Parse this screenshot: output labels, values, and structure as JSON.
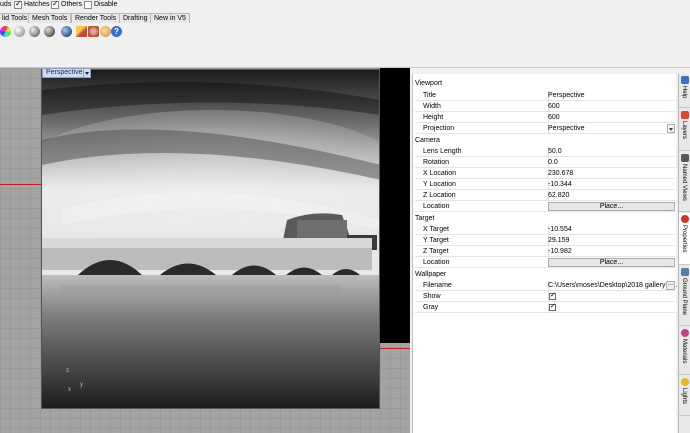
{
  "filter_bar": {
    "items": [
      {
        "label": "uds",
        "checked": true
      },
      {
        "label": "Hatches",
        "checked": true
      },
      {
        "label": "Others",
        "checked": true
      },
      {
        "label": "Disable",
        "checked": false
      }
    ]
  },
  "tabs": [
    "lid Tools",
    "Mesh Tools",
    "Render Tools",
    "Drafting",
    "New in V5"
  ],
  "toolbar_icons": [
    "color-wheel-icon",
    "shaded-sphere-icon",
    "render-sphere-icon",
    "material-sphere-icon",
    "blue-sphere-icon",
    "light-icon",
    "paint-icon",
    "environment-icon",
    "help-icon"
  ],
  "viewport": {
    "label": "Perspective",
    "axis_x": "x",
    "axis_y": "y",
    "axis_z": "z"
  },
  "properties": {
    "viewport_section": "Viewport",
    "viewport_rows": [
      {
        "key": "Title",
        "value": "Perspective"
      },
      {
        "key": "Width",
        "value": "600"
      },
      {
        "key": "Height",
        "value": "600"
      },
      {
        "key": "Projection",
        "value": "Perspective"
      }
    ],
    "camera_section": "Camera",
    "camera_rows": [
      {
        "key": "Lens Length",
        "value": "50.0"
      },
      {
        "key": "Rotation",
        "value": "0.0"
      },
      {
        "key": "X Location",
        "value": "230.678"
      },
      {
        "key": "Y Location",
        "value": "-10.344"
      },
      {
        "key": "Z Location",
        "value": "62.820"
      },
      {
        "key": "Location",
        "value": "Place..."
      }
    ],
    "target_section": "Target",
    "target_rows": [
      {
        "key": "X Target",
        "value": "-10.554"
      },
      {
        "key": "Y Target",
        "value": "29.159"
      },
      {
        "key": "Z Target",
        "value": "-10.982"
      },
      {
        "key": "Location",
        "value": "Place..."
      }
    ],
    "wallpaper_section": "Wallpaper",
    "wallpaper_rows": [
      {
        "key": "Filename",
        "value": "C:\\Users\\moses\\Desktop\\2018 gallery 3...",
        "button": "..."
      },
      {
        "key": "Show",
        "checked": true
      },
      {
        "key": "Gray",
        "checked": true
      }
    ]
  },
  "side_tabs": [
    {
      "label": "Help",
      "icon": "help-icon",
      "color": "#3a6fc8"
    },
    {
      "label": "Layers",
      "icon": "layers-icon",
      "color": "#d84a2a"
    },
    {
      "label": "Named Views",
      "icon": "camera-icon",
      "color": "#555555"
    },
    {
      "label": "Properties",
      "icon": "properties-icon",
      "color": "#d4342a"
    },
    {
      "label": "Ground Plane",
      "icon": "ground-plane-icon",
      "color": "#5a7aa8"
    },
    {
      "label": "Materials",
      "icon": "materials-icon",
      "color": "#c83c8c"
    },
    {
      "label": "Lights",
      "icon": "lights-icon",
      "color": "#e8b820"
    }
  ]
}
